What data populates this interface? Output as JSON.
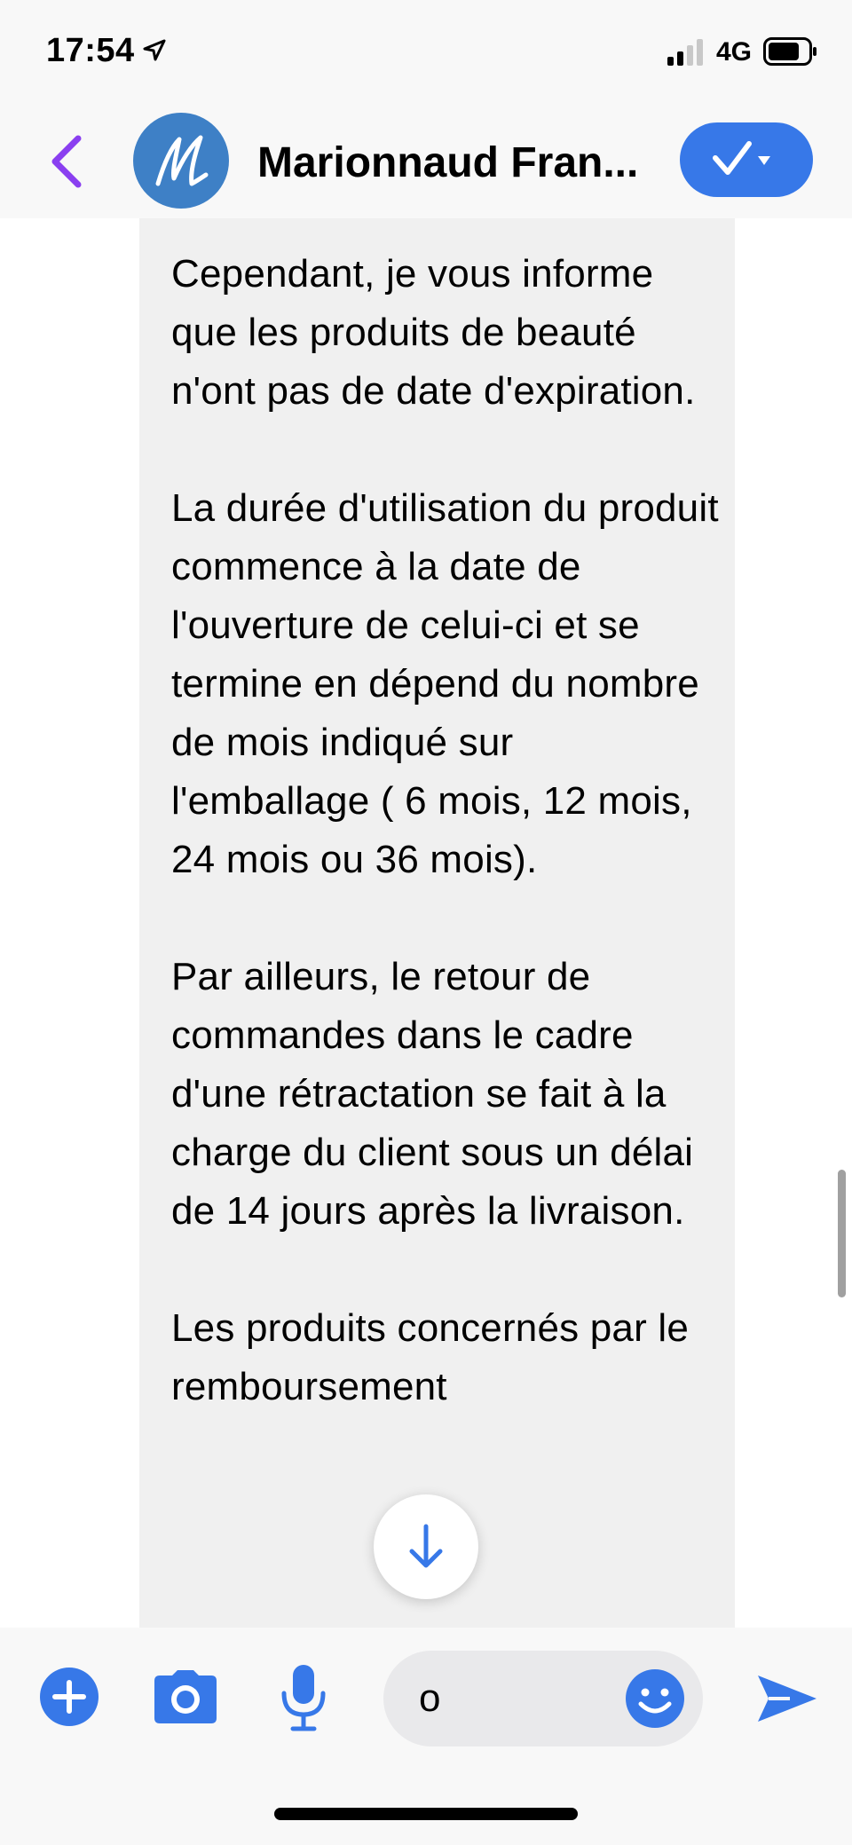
{
  "status_bar": {
    "time": "17:54",
    "network": "4G",
    "icons": [
      "location-arrow-icon",
      "signal-bars-icon",
      "battery-icon"
    ]
  },
  "header": {
    "contact_name": "Marionnaud Fran...",
    "avatar_letter": "M",
    "avatar_color": "#3e80c6",
    "back_icon": "chevron-left-icon",
    "action_icon": "checkmark-dropdown-icon"
  },
  "message": {
    "paragraphs": [
      "Cependant, je vous informe que les produits de beauté n'ont pas de date d'expiration.",
      "La durée d'utilisation du produit commence à la date de l'ouverture de celui-ci et se termine en dépend du nombre de mois indiqué sur l'emballage ( 6 mois, 12 mois, 24 mois ou 36 mois).",
      "Par ailleurs, le retour de commandes dans le cadre d'une rétractation se fait à la charge du client sous un délai de 14 jours après la livraison.",
      "Les produits concernés par le remboursement"
    ],
    "bubble_color": "#f0f0f0"
  },
  "composer": {
    "input_value": "o",
    "icons": [
      "plus-icon",
      "camera-icon",
      "microphone-icon",
      "emoji-icon",
      "send-icon"
    ]
  },
  "colors": {
    "accent_blue": "#3778e8",
    "back_purple": "#8a3ff0"
  }
}
